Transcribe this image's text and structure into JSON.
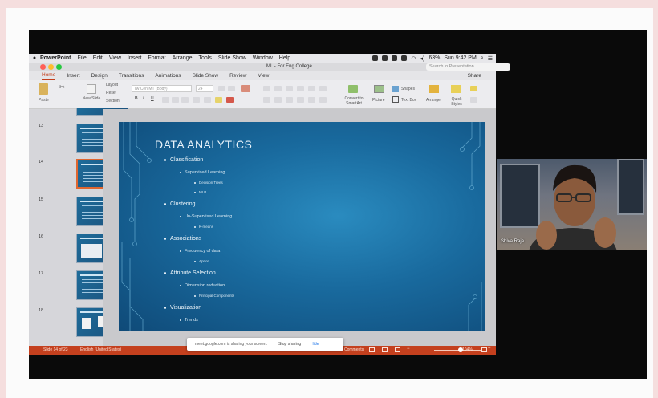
{
  "menubar": {
    "app_name": "PowerPoint",
    "items": [
      "File",
      "Edit",
      "View",
      "Insert",
      "Format",
      "Arrange",
      "Tools",
      "Slide Show",
      "Window",
      "Help"
    ],
    "battery": "63%",
    "clock": "Sun 9:42 PM"
  },
  "window": {
    "doc_title": "ML - For Eng College",
    "search_placeholder": "Search in Presentation"
  },
  "ribbon": {
    "tabs": [
      "Home",
      "Insert",
      "Design",
      "Transitions",
      "Animations",
      "Slide Show",
      "Review",
      "View"
    ],
    "active_tab": "Home",
    "share_label": "Share",
    "paste": "Paste",
    "new_slide": "New Slide",
    "layout": "Layout",
    "reset": "Reset",
    "section": "Section",
    "font_name": "Tw Cen MT (Body)",
    "font_size": "24",
    "convert_smartart": "Convert to SmartArt",
    "picture": "Picture",
    "shapes": "Shapes",
    "text_box": "Text Box",
    "arrange": "Arrange",
    "quick_styles": "Quick Styles"
  },
  "thumbnails": [
    {
      "number": "13",
      "selected": false
    },
    {
      "number": "14",
      "selected": true
    },
    {
      "number": "15",
      "selected": false
    },
    {
      "number": "16",
      "selected": false
    },
    {
      "number": "17",
      "selected": false
    },
    {
      "number": "18",
      "selected": false
    }
  ],
  "slide": {
    "title": "DATA ANALYTICS",
    "bullets": [
      {
        "level": 1,
        "text": "Classification"
      },
      {
        "level": 2,
        "text": "Supervised Learning"
      },
      {
        "level": 3,
        "text": "Decision Trees"
      },
      {
        "level": 3,
        "text": "MLP"
      },
      {
        "level": 1,
        "text": "Clustering"
      },
      {
        "level": 2,
        "text": "Un-Supervised Learning"
      },
      {
        "level": 3,
        "text": "K-means"
      },
      {
        "level": 1,
        "text": "Associations"
      },
      {
        "level": 2,
        "text": "Frequency of data"
      },
      {
        "level": 3,
        "text": "Apriori"
      },
      {
        "level": 1,
        "text": "Attribute Selection"
      },
      {
        "level": 2,
        "text": "Dimension reduction"
      },
      {
        "level": 3,
        "text": "Principal Components"
      },
      {
        "level": 1,
        "text": "Visualization"
      },
      {
        "level": 2,
        "text": "Trends"
      }
    ]
  },
  "statusbar": {
    "slide_info": "Slide 14 of 23",
    "language": "English (United States)",
    "comments": "Comments",
    "zoom": "104%"
  },
  "share_banner": {
    "message": "meet.google.com is sharing your screen.",
    "stop_label": "Stop sharing",
    "hide_label": "Hide"
  },
  "participant": {
    "name": "Shiva Raja"
  },
  "colors": {
    "accent": "#c43e1c",
    "slide_bg": "#196a9e",
    "page_bg": "#f5dede"
  }
}
